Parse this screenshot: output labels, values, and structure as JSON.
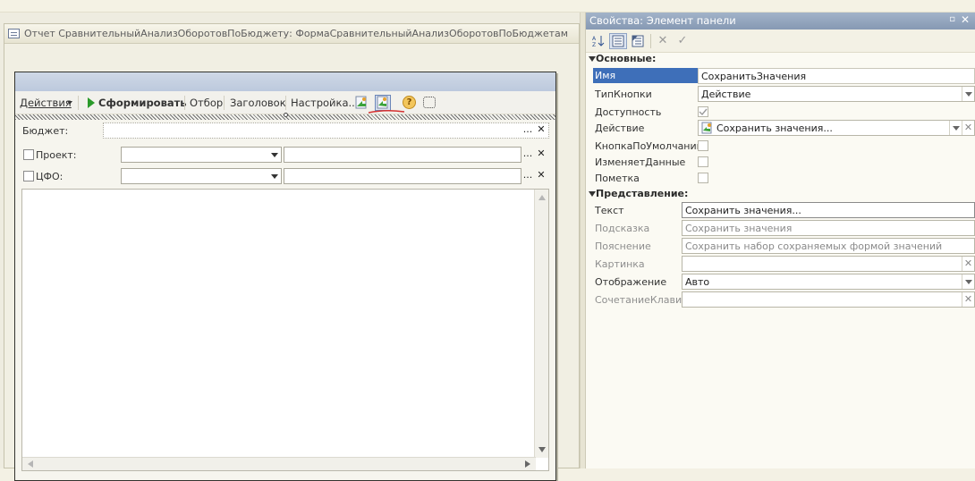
{
  "editor": {
    "title": "Отчет СравнительныйАнализОборотовПоБюджету: ФормаСравнительныйАнализОборотовПоБюджетам"
  },
  "form": {
    "toolbar": {
      "actions_label": "Действия",
      "generate_label": "Сформировать",
      "filter_label": "Отбор",
      "header_label": "Заголовок",
      "settings_label": "Настройка..."
    },
    "fields": {
      "budget_label": "Бюджет:",
      "project_label": "Проект:",
      "cfo_label": "ЦФО:",
      "ellipsis": "...",
      "clear": "✕"
    },
    "icons": [
      "load-settings-icon",
      "save-settings-icon",
      "help-icon",
      "frame-select-icon"
    ]
  },
  "props": {
    "title": "Свойства: Элемент панели",
    "title_pin": "▫",
    "title_close": "✕",
    "toolbar_icons": [
      "sort-alpha-icon",
      "categories-icon",
      "properties-list-icon",
      "cancel-icon",
      "apply-icon"
    ],
    "section_main": "Основные:",
    "section_view": "Представление:",
    "rows": {
      "name_label": "Имя",
      "name_value": "СохранитьЗначения",
      "button_type_label": "ТипКнопки",
      "button_type_value": "Действие",
      "availability_label": "Доступность",
      "action_label": "Действие",
      "action_value": "Сохранить значения...",
      "default_button_label": "КнопкаПоУмолчанию",
      "changes_data_label": "ИзменяетДанные",
      "mark_label": "Пометка",
      "text_label": "Текст",
      "text_value": "Сохранить значения...",
      "tooltip_label": "Подсказка",
      "tooltip_value": "Сохранить значения",
      "explanation_label": "Пояснение",
      "explanation_value": "Сохранить набор сохраняемых формой значений",
      "picture_label": "Картинка",
      "display_label": "Отображение",
      "display_value": "Авто",
      "shortcut_label": "СочетаниеКлавиш"
    },
    "states": {
      "availability": true,
      "default_button": false,
      "changes_data": false,
      "mark": false
    }
  },
  "colors": {
    "selection": "#3e6fb9",
    "panel_title": "#8699b3",
    "accent_green": "#2a9a2a"
  }
}
